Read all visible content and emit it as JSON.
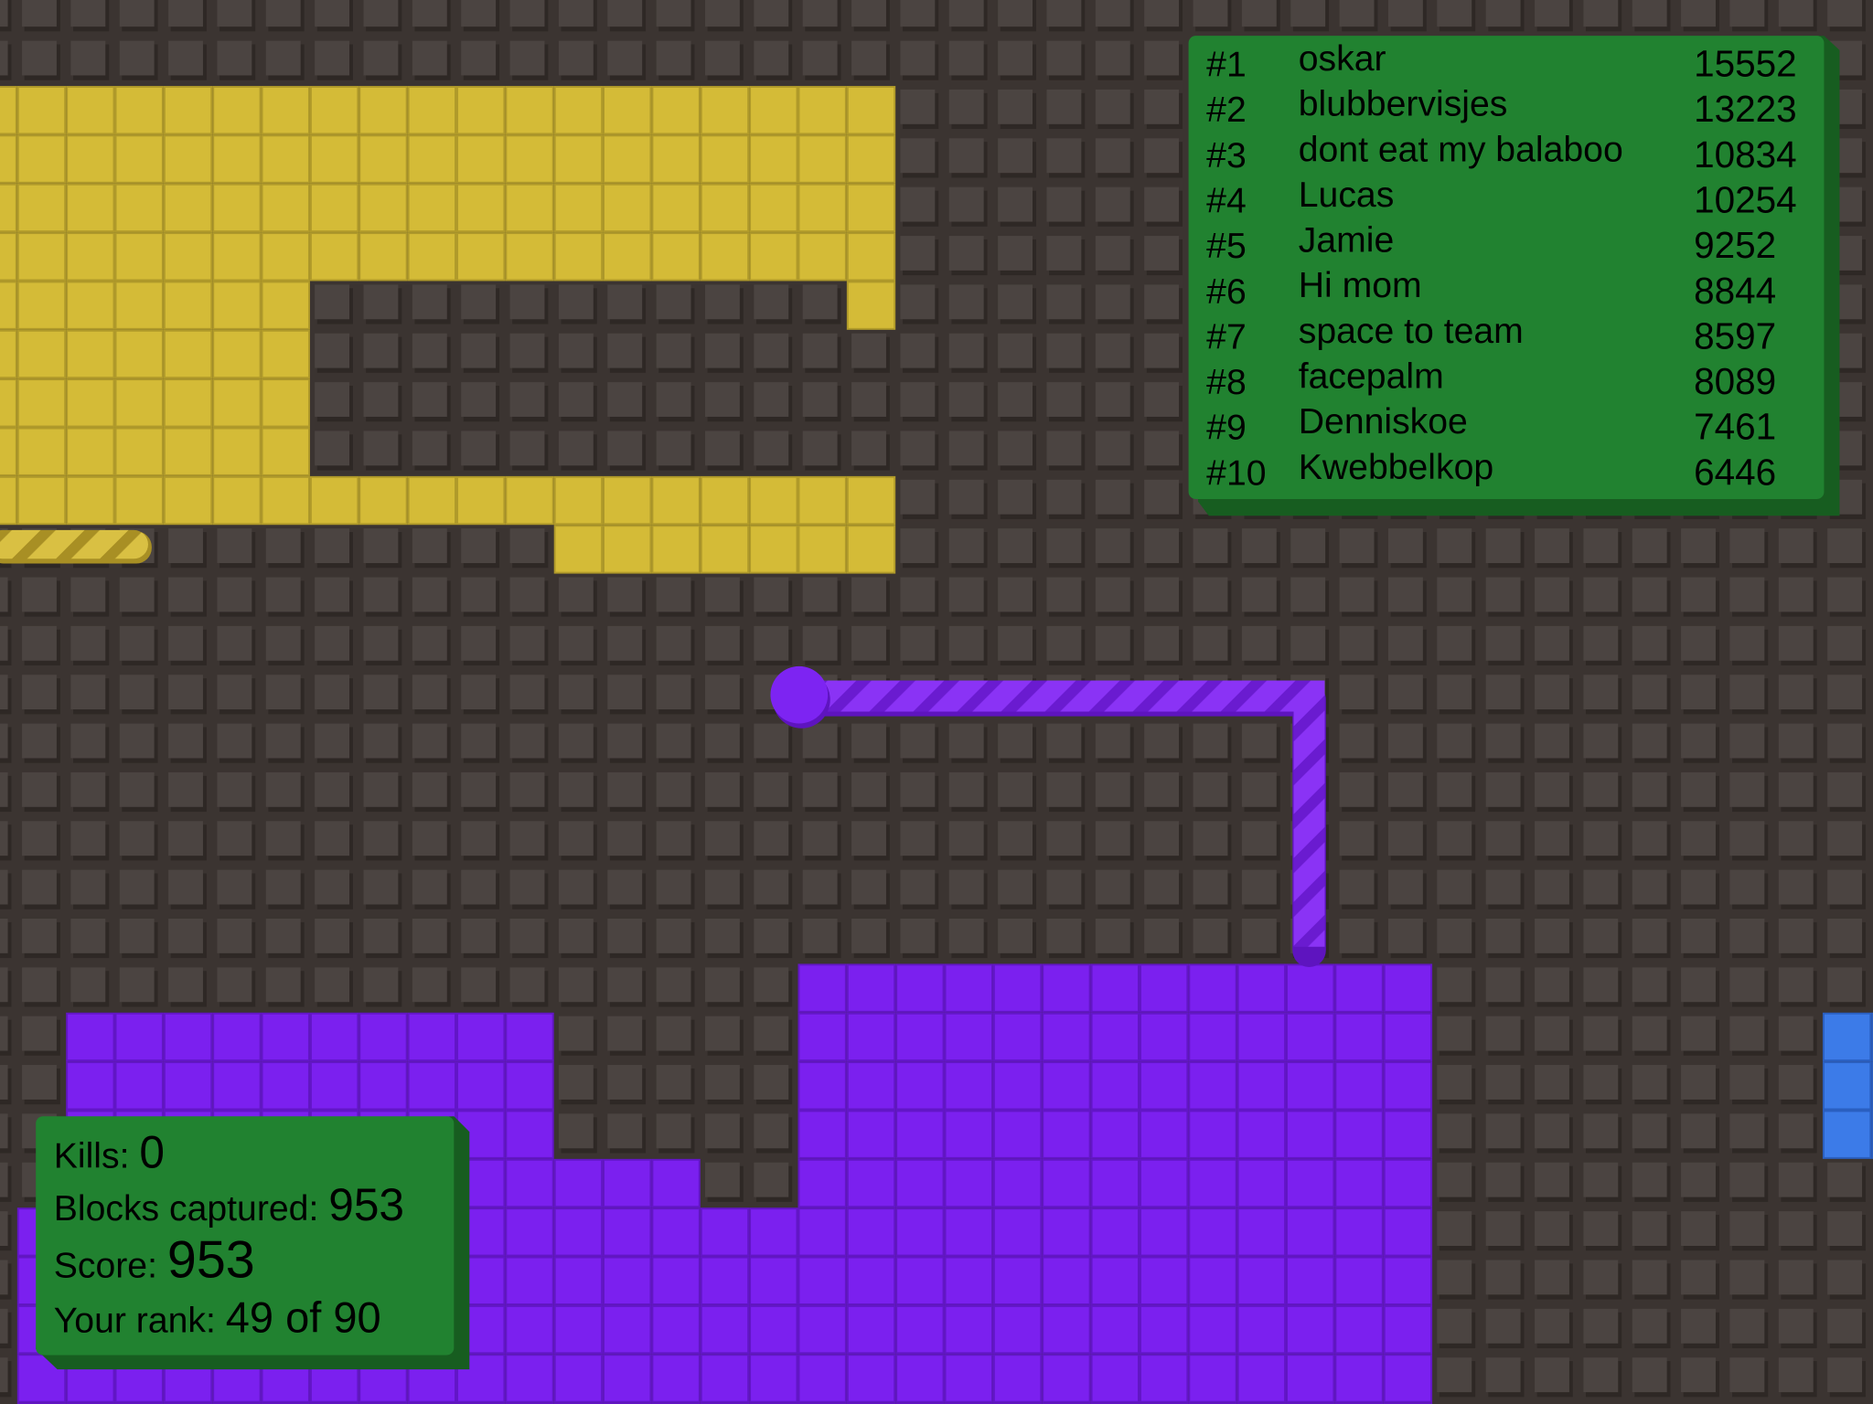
{
  "colors": {
    "background": "#3b3431",
    "tile": "#4b4441",
    "tile_shadow": "#2e2825",
    "yellow_player": "#d4bb37",
    "yellow_player_dark": "#b09a2a",
    "purple_player": "#7b20ef",
    "purple_player_dark": "#6216c6",
    "blue_player": "#3c7be8",
    "blue_player_dark": "#2a5fc0",
    "panel": "#218230",
    "panel_shadow": "#175d20"
  },
  "leaderboard": {
    "entries": [
      {
        "rank": "#1",
        "name": "oskar",
        "score": "15552"
      },
      {
        "rank": "#2",
        "name": "blubbervisjes",
        "score": "13223"
      },
      {
        "rank": "#3",
        "name": "dont eat my balaboo",
        "score": "10834"
      },
      {
        "rank": "#4",
        "name": "Lucas",
        "score": "10254"
      },
      {
        "rank": "#5",
        "name": "Jamie",
        "score": "9252"
      },
      {
        "rank": "#6",
        "name": "Hi mom",
        "score": "8844"
      },
      {
        "rank": "#7",
        "name": "space to team",
        "score": "8597"
      },
      {
        "rank": "#8",
        "name": "facepalm",
        "score": "8089"
      },
      {
        "rank": "#9",
        "name": "Denniskoe",
        "score": "7461"
      },
      {
        "rank": "#10",
        "name": "Kwebbelkop",
        "score": "6446"
      }
    ]
  },
  "stats": {
    "kills_label": "Kills: ",
    "kills": "0",
    "blocks_label": "Blocks captured: ",
    "blocks": "953",
    "score_label": "Score: ",
    "score": "953",
    "rank_label": "Your rank: ",
    "rank": "49 of 90"
  }
}
